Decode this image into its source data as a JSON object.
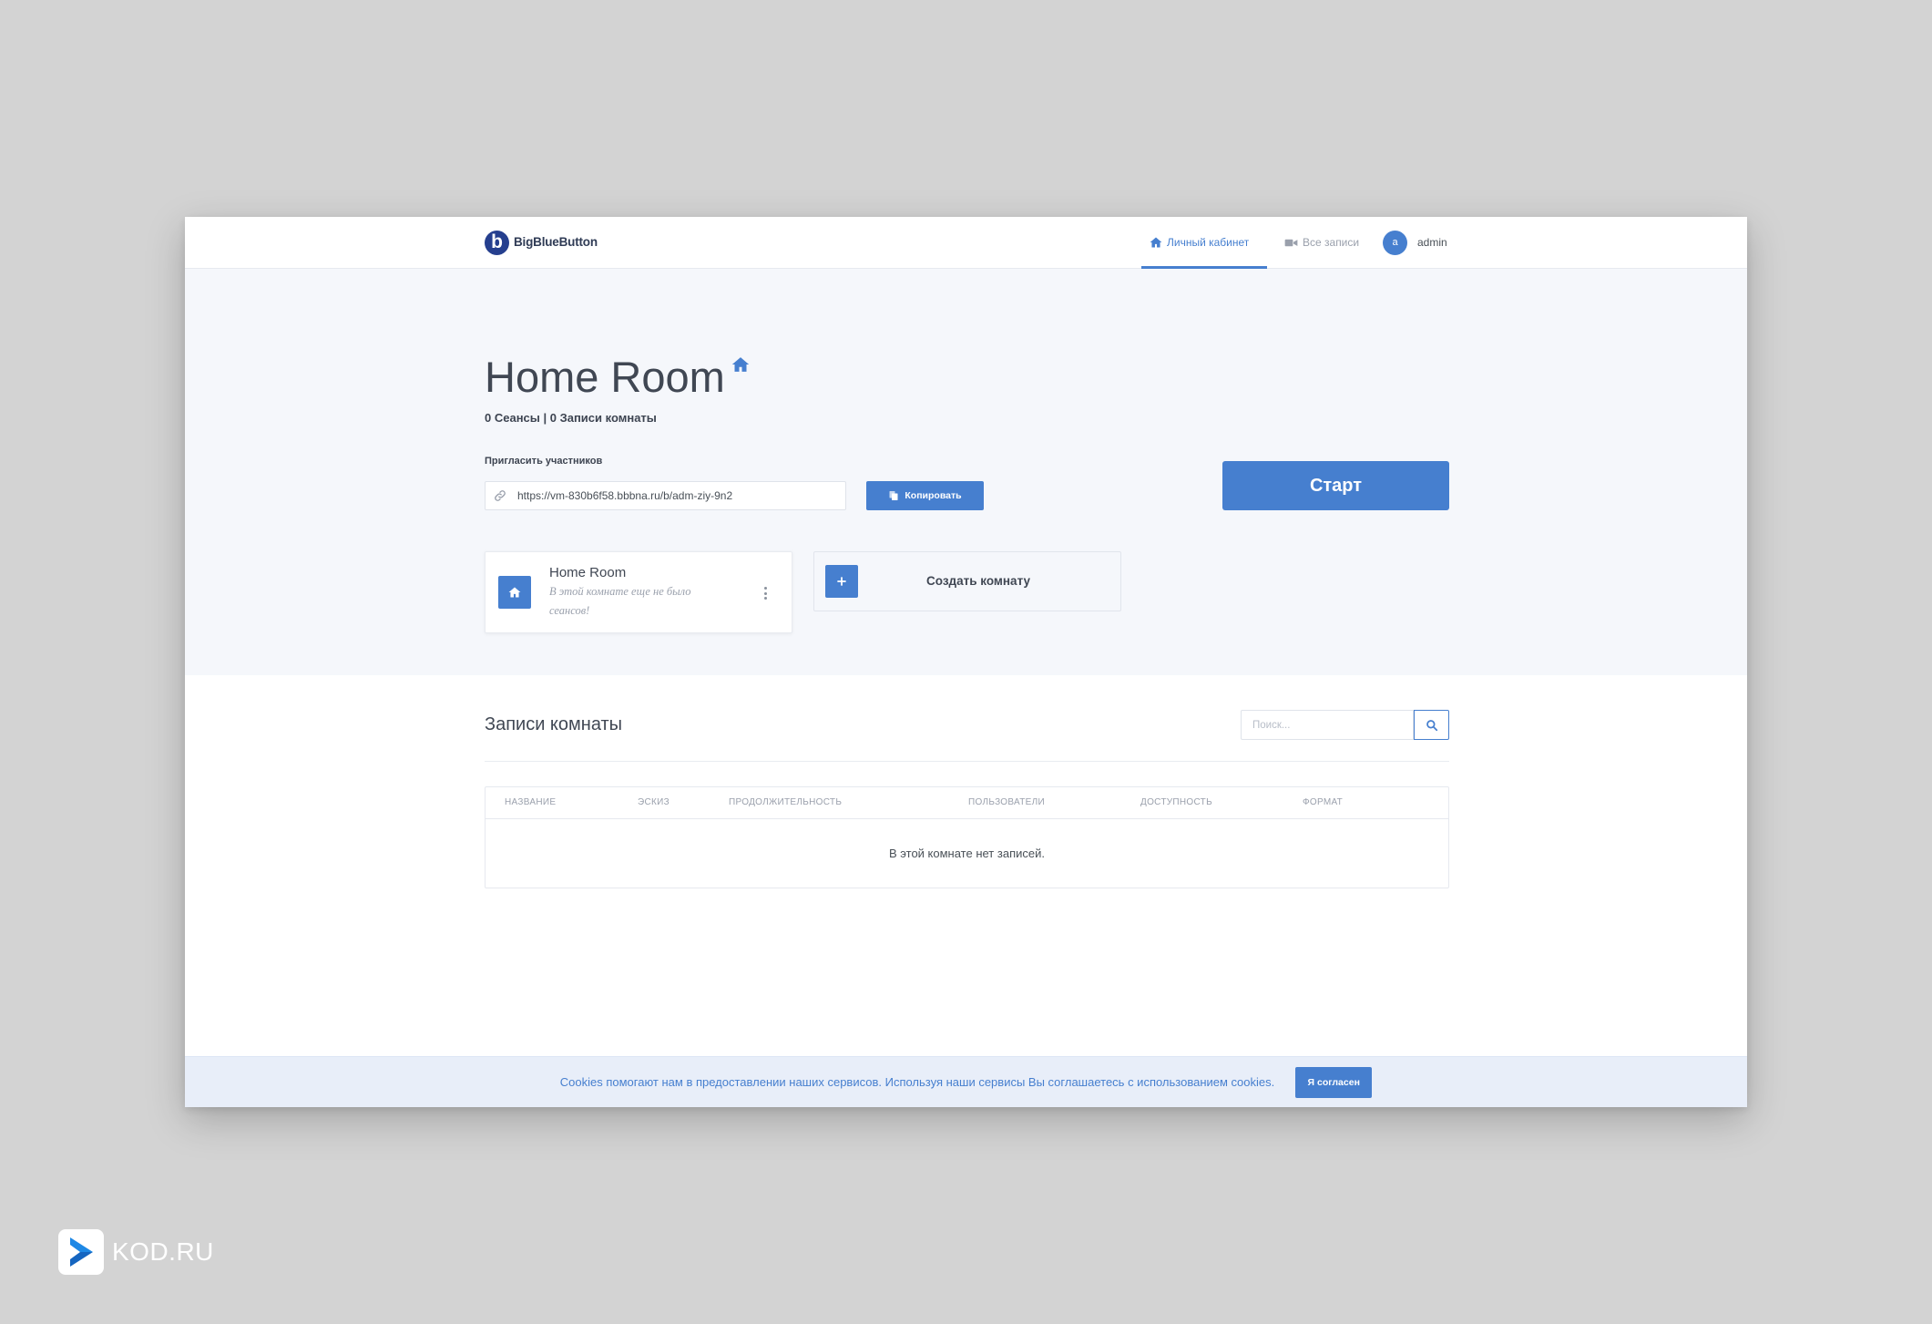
{
  "brand": {
    "name": "BigBlueButton",
    "logo_letter": "b"
  },
  "nav": {
    "items": [
      {
        "label": "Личный кабинет",
        "icon": "home-icon",
        "active": true
      },
      {
        "label": "Все записи",
        "icon": "video-icon",
        "active": false
      }
    ],
    "user": {
      "avatar_letter": "a",
      "name": "admin"
    }
  },
  "room": {
    "title": "Home Room",
    "title_icon": "home-icon",
    "stats": "0 Сеансы | 0 Записи комнаты",
    "invite_label": "Пригласить участников",
    "invite_url": "https://vm-830b6f58.bbbna.ru/b/adm-ziy-9n2",
    "invite_icon": "link-icon",
    "copy_label": "Копировать",
    "copy_icon": "copy-icon",
    "start_label": "Старт"
  },
  "rooms_list": [
    {
      "name": "Home Room",
      "subtitle": "В этой комнате еще не было сеансов!",
      "icon": "home-icon",
      "menu_icon": "kebab-icon"
    }
  ],
  "create_room": {
    "label": "Создать комнату",
    "icon": "plus-icon"
  },
  "recordings": {
    "title": "Записи комнаты",
    "search_placeholder": "Поиск...",
    "search_icon": "search-icon",
    "columns": [
      "НАЗВАНИЕ",
      "ЭСКИЗ",
      "ПРОДОЛЖИТЕЛЬНОСТЬ",
      "ПОЛЬЗОВАТЕЛИ",
      "ДОСТУПНОСТЬ",
      "ФОРМАТ"
    ],
    "empty_message": "В этой комнате нет записей."
  },
  "cookie_banner": {
    "text": "Cookies помогают нам в предоставлении наших сервисов. Используя наши сервисы Вы соглашаетесь с использованием cookies.",
    "accept_label": "Я согласен"
  },
  "watermark": {
    "text": "KOD.RU",
    "icon": "kod-logo-icon"
  },
  "colors": {
    "primary": "#467fcf",
    "page_background": "#d3d3d3",
    "hero_background": "#f5f7fb",
    "cookie_background": "#e8eef9",
    "muted_text": "#9aa0ac",
    "dark_text": "#3d4451"
  }
}
